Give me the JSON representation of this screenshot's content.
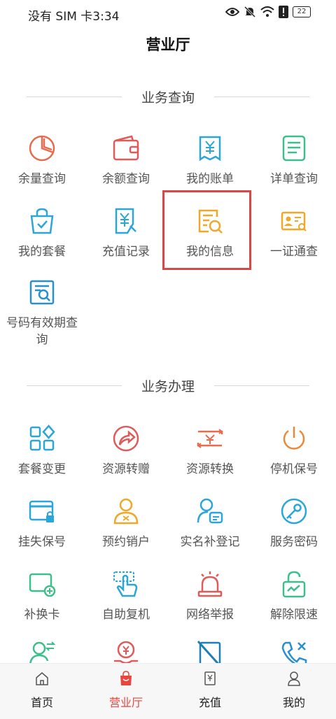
{
  "status": {
    "text": "没有 SIM 卡3:34",
    "battery": "22"
  },
  "page_title": "营业厅",
  "sections": {
    "query": {
      "title": "业务查询",
      "items": [
        "余量查询",
        "余额查询",
        "我的账单",
        "详单查询",
        "我的套餐",
        "充值记录",
        "我的信息",
        "一证通查",
        "号码有效期查询"
      ]
    },
    "handle": {
      "title": "业务办理",
      "items": [
        "套餐变更",
        "资源转赠",
        "资源转换",
        "停机保号",
        "挂失保号",
        "预约销户",
        "实名补登记",
        "服务密码",
        "补换卡",
        "自助复机",
        "网络举报",
        "解除限速"
      ]
    }
  },
  "tabs": [
    "首页",
    "营业厅",
    "充值",
    "我的"
  ],
  "colors": {
    "accent": "#e8463e",
    "highlight": "#d94848"
  }
}
